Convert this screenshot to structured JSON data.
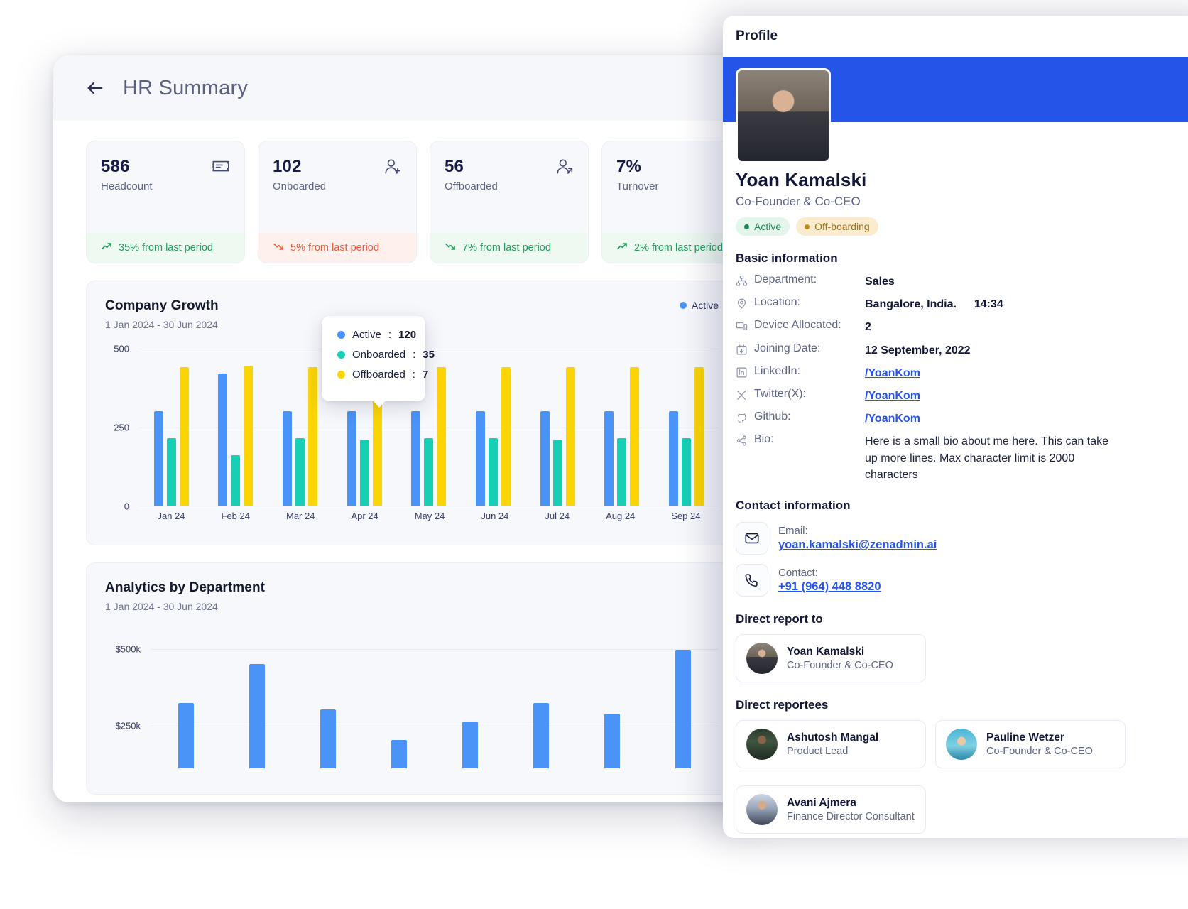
{
  "dashboard": {
    "header": {
      "title": "HR Summary",
      "back_icon": "arrow-left-icon"
    },
    "kpis": [
      {
        "value": "586",
        "label": "Headcount",
        "icon": "badge-id-icon",
        "delta": "35% from last period",
        "direction": "up"
      },
      {
        "value": "102",
        "label": "Onboarded",
        "icon": "user-plus-icon",
        "delta": "5% from last period",
        "direction": "down"
      },
      {
        "value": "56",
        "label": "Offboarded",
        "icon": "user-arrow-icon",
        "delta": "7% from last period",
        "direction": "up"
      },
      {
        "value": "7%",
        "label": "Turnover",
        "icon": "user-arrow-icon",
        "delta": "2% from last period",
        "direction": "up"
      }
    ],
    "growth_panel": {
      "title": "Company Growth",
      "subtitle": "1 Jan 2024 - 30 Jun 2024",
      "legend": [
        {
          "label": "Active",
          "color": "#4a93f7"
        }
      ]
    },
    "tooltip": {
      "rows": [
        {
          "label": "Active",
          "value": "120",
          "color": "#4a93f7"
        },
        {
          "label": "Onboarded",
          "value": "35",
          "color": "#16cfb4"
        },
        {
          "label": "Offboarded",
          "value": "7",
          "color": "#fbd503"
        }
      ]
    },
    "dept_panel": {
      "title": "Analytics by Department",
      "subtitle": "1 Jan 2024 - 30 Jun 2024"
    }
  },
  "chart_data": [
    {
      "type": "bar",
      "title": "Company Growth",
      "subtitle": "1 Jan 2024 - 30 Jun 2024",
      "categories": [
        "Jan 24",
        "Feb 24",
        "Mar 24",
        "Apr 24",
        "May 24",
        "Jun 24",
        "Jul 24",
        "Aug 24",
        "Sep 24"
      ],
      "series": [
        {
          "name": "Active",
          "color": "#4a93f7",
          "values": [
            300,
            420,
            300,
            300,
            300,
            300,
            300,
            300,
            300
          ]
        },
        {
          "name": "Onboarded",
          "color": "#16cfb4",
          "values": [
            215,
            160,
            215,
            210,
            215,
            215,
            210,
            215,
            215
          ]
        },
        {
          "name": "Offboarded",
          "color": "#fbd503",
          "values": [
            440,
            445,
            440,
            440,
            440,
            440,
            440,
            440,
            440
          ]
        }
      ],
      "xlabel": "",
      "ylabel": "",
      "ylim": [
        0,
        500
      ],
      "yticks": [
        0,
        250,
        500
      ],
      "ytick_labels": [
        "0",
        "250",
        "500"
      ],
      "grid": true,
      "legend_position": "top-right"
    },
    {
      "type": "bar",
      "title": "Analytics by Department",
      "subtitle": "1 Jan 2024 - 30 Jun 2024",
      "categories": [
        "",
        "",
        "",
        "",
        "",
        "",
        "",
        ""
      ],
      "series": [
        {
          "name": "Spend",
          "color": "#4a93f7",
          "values": [
            270000,
            430000,
            245000,
            120000,
            195000,
            270000,
            225000,
            490000
          ]
        }
      ],
      "xlabel": "",
      "ylabel": "",
      "ylim": [
        0,
        560000
      ],
      "yticks": [
        250000,
        500000
      ],
      "ytick_labels": [
        "$250k",
        "$500k"
      ],
      "grid": true,
      "legend_position": "none"
    }
  ],
  "profile": {
    "header": {
      "title": "Profile",
      "close_icon": "close-icon"
    },
    "name": "Yoan Kamalski",
    "role": "Co-Founder & Co-CEO",
    "badges": [
      {
        "label": "Active",
        "type": "active"
      },
      {
        "label": "Off-boarding",
        "type": "offboarding"
      }
    ],
    "basic_title": "Basic information",
    "basic": [
      {
        "icon": "org-chart-icon",
        "key": "Department:",
        "value": "Sales",
        "link": false
      },
      {
        "icon": "location-pin-icon",
        "key": "Location:",
        "value": "Bangalore, India.",
        "extra": "14:34",
        "link": false
      },
      {
        "icon": "device-icon",
        "key": "Device Allocated:",
        "value": "2",
        "link": false
      },
      {
        "icon": "calendar-plus-icon",
        "key": "Joining Date:",
        "value": "12 September, 2022",
        "link": false
      },
      {
        "icon": "linkedin-icon",
        "key": "LinkedIn:",
        "value": "/YoanKom",
        "link": true
      },
      {
        "icon": "twitter-x-icon",
        "key": "Twitter(X):",
        "value": "/YoanKom",
        "link": true
      },
      {
        "icon": "github-icon",
        "key": "Github:",
        "value": "/YoanKom",
        "link": true
      },
      {
        "icon": "share-icon",
        "key": "Bio:",
        "value": "Here is a small bio about me here.  This can take up more lines. Max character limit is 2000 characters",
        "link": false
      }
    ],
    "contact_title": "Contact information",
    "contacts": [
      {
        "icon": "mail-icon",
        "label": "Email:",
        "value": "yoan.kamalski@zenadmin.ai"
      },
      {
        "icon": "phone-icon",
        "label": "Contact:",
        "value": "+91 (964) 448 8820"
      }
    ],
    "report_to_title": "Direct report to",
    "report_to": [
      {
        "name": "Yoan Kamalski",
        "role": "Co-Founder & Co-CEO",
        "photo": "ph1"
      }
    ],
    "reportees_title": "Direct reportees",
    "reportees": [
      {
        "name": "Ashutosh Mangal",
        "role": "Product Lead",
        "photo": "ph2"
      },
      {
        "name": "Pauline Wetzer",
        "role": "Co-Founder & Co-CEO",
        "photo": "ph3"
      },
      {
        "name": "Avani Ajmera",
        "role": "Finance Director Consultant",
        "photo": "ph4"
      }
    ]
  },
  "colors": {
    "accent_blue": "#2554e8",
    "bar_active": "#4a93f7",
    "bar_onboarded": "#16cfb4",
    "bar_offboarded": "#fbd503",
    "positive": "#1f9d59",
    "negative": "#f1593b"
  }
}
